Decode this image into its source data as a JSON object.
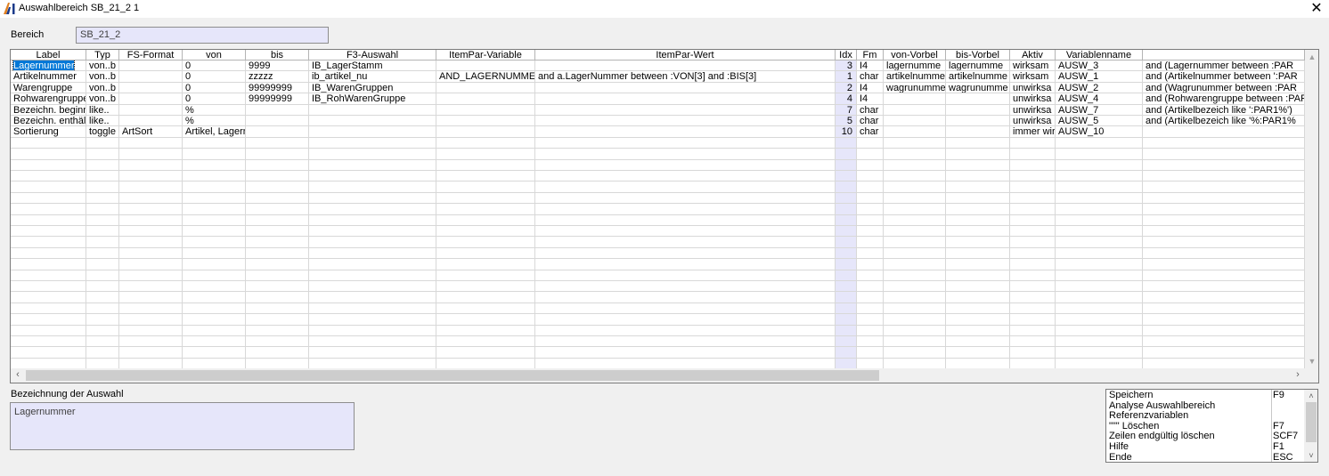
{
  "window": {
    "title": "Auswahlbereich SB_21_2 1",
    "close_glyph": "✕"
  },
  "bereich": {
    "label": "Bereich",
    "value": "SB_21_2"
  },
  "grid": {
    "columns": [
      "Label",
      "Typ",
      "FS-Format",
      "von",
      "bis",
      "F3-Auswahl",
      "ItemPar-Variable",
      "ItemPar-Wert",
      "Idx",
      "Fm",
      "von-Vorbel",
      "bis-Vorbel",
      "Aktiv",
      "Variablenname",
      ""
    ],
    "rows": [
      [
        "Lagernummer",
        "von..b",
        "",
        "0",
        "9999",
        "IB_LagerStamm",
        "",
        "",
        "3",
        "I4",
        "lagernumme",
        "lagernumme",
        "wirksam",
        "AUSW_3",
        "and (Lagernummer between :PAR"
      ],
      [
        "Artikelnummer",
        "von..b",
        "",
        "0",
        "zzzzz",
        "ib_artikel_nu",
        "AND_LAGERNUMMER",
        "and a.LagerNummer between :VON[3] and :BIS[3]",
        "1",
        "char",
        "artikelnumme",
        "artikelnumme",
        "wirksam",
        "AUSW_1",
        "and (Artikelnummer between ':PAR"
      ],
      [
        "Warengruppe",
        "von..b",
        "",
        "0",
        "99999999",
        "IB_WarenGruppen",
        "",
        "",
        "2",
        "I4",
        "wagrunumme",
        "wagrunumme",
        "unwirksa",
        "AUSW_2",
        "and (Wagrunummer between :PAR"
      ],
      [
        "Rohwarengruppe",
        "von..b",
        "",
        "0",
        "99999999",
        "IB_RohWarenGruppe",
        "",
        "",
        "4",
        "I4",
        "",
        "",
        "unwirksa",
        "AUSW_4",
        "and (Rohwarengruppe between :PAR"
      ],
      [
        "Bezeichn. beginnt",
        "like..",
        "",
        "%",
        "",
        "",
        "",
        "",
        "7",
        "char",
        "",
        "",
        "unwirksa",
        "AUSW_7",
        "and (Artikelbezeich like ':PAR1%')"
      ],
      [
        "Bezeichn. enthält",
        "like..",
        "",
        "%",
        "",
        "",
        "",
        "",
        "5",
        "char",
        "",
        "",
        "unwirksa",
        "AUSW_5",
        "and (Artikelbezeich like '%:PAR1%"
      ],
      [
        "Sortierung",
        "toggle",
        "ArtSort",
        "Artikel, Lagernummer",
        "",
        "",
        "",
        "",
        "10",
        "char",
        "",
        "",
        "immer wirksam",
        "AUSW_10",
        ""
      ]
    ],
    "selected_cell": "Lagernummer"
  },
  "description": {
    "label": "Bezeichnung der Auswahl",
    "value": "Lagernummer"
  },
  "menu": {
    "items": [
      {
        "label": "Speichern",
        "key": "F9"
      },
      {
        "label": "Analyse Auswahlbereich",
        "key": ""
      },
      {
        "label": "Referenzvariablen",
        "key": ""
      },
      {
        "label": "\"\"\" Löschen",
        "key": "F7"
      },
      {
        "label": "Zeilen endgültig löschen",
        "key": "SCF7"
      },
      {
        "label": "Hilfe",
        "key": "F1"
      },
      {
        "label": "Ende",
        "key": "ESC"
      }
    ]
  },
  "icons": {
    "app": "app-logo-icon",
    "close": "close-icon",
    "scroll_up": "chevron-up-icon",
    "scroll_down": "chevron-down-icon",
    "scroll_left": "chevron-left-icon",
    "scroll_right": "chevron-right-icon"
  },
  "colors": {
    "field_bg": "#e6e6fa",
    "selection": "#0078d7",
    "logo_orange": "#e08020",
    "logo_blue": "#1a3a8a"
  }
}
